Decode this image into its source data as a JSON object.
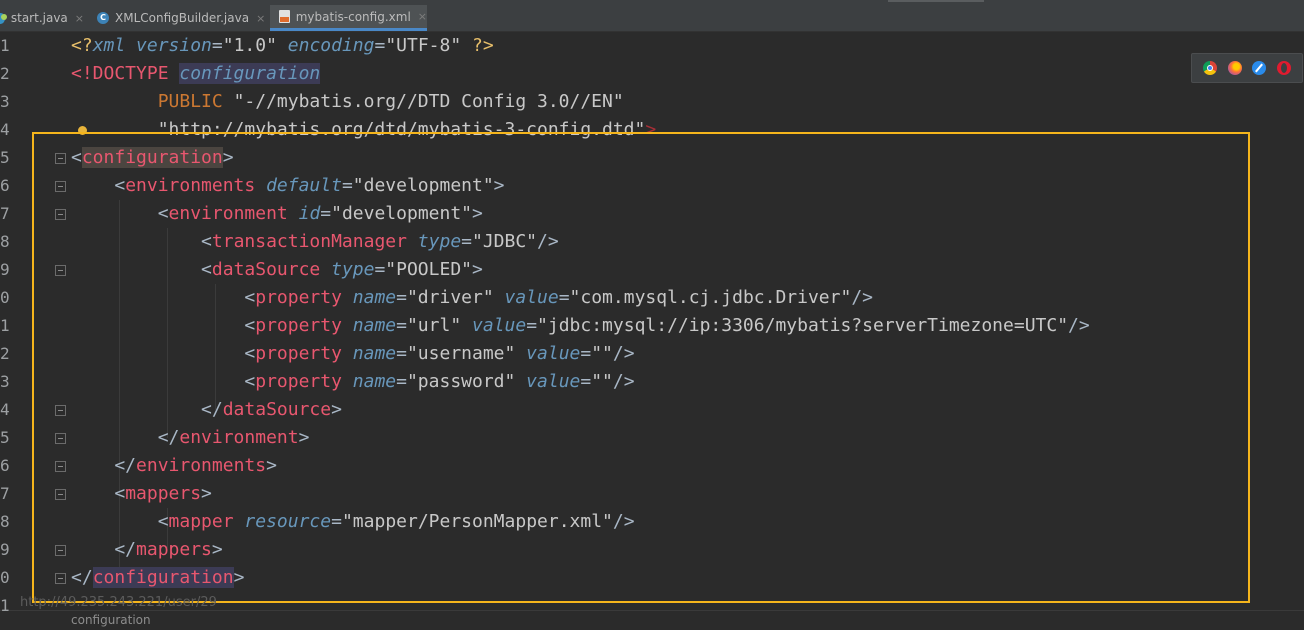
{
  "tabs": [
    {
      "label": "start.java",
      "icon": "java-file-icon",
      "active": false
    },
    {
      "label": "XMLConfigBuilder.java",
      "icon": "class-icon",
      "active": false
    },
    {
      "label": "mybatis-config.xml",
      "icon": "xml-file-icon",
      "active": true
    }
  ],
  "tab_close_glyph": "×",
  "browser_icons": [
    "chrome-icon",
    "firefox-icon",
    "safari-icon",
    "opera-icon"
  ],
  "line_numbers": [
    "1",
    "2",
    "3",
    "4",
    "5",
    "6",
    "7",
    "8",
    "9",
    "0",
    "1",
    "2",
    "3",
    "4",
    "5",
    "6",
    "7",
    "8",
    "9",
    "0",
    "1"
  ],
  "code": {
    "l1": {
      "a": "<?",
      "b": "xml",
      "c": " version",
      "d": "=",
      "e": "\"1.0\"",
      "f": " encoding",
      "g": "=",
      "h": "\"UTF-8\"",
      "i": " ?>"
    },
    "l2": {
      "a": "<!DOCTYPE ",
      "b": "configuration"
    },
    "l3": {
      "a": "        PUBLIC ",
      "b": "\"-//mybatis.org//DTD Config 3.0//EN\""
    },
    "l4": {
      "a": "        \"http://mybatis.org/dtd/mybatis-3-config.dtd\"",
      "b": ">"
    },
    "l5": {
      "a": "<",
      "b": "configuration",
      "c": ">"
    },
    "l6": {
      "a": "    <",
      "b": "environments",
      "c": " default",
      "d": "=",
      "e": "\"development\"",
      "f": ">"
    },
    "l7": {
      "a": "        <",
      "b": "environment",
      "c": " id",
      "d": "=",
      "e": "\"development\"",
      "f": ">"
    },
    "l8": {
      "a": "            <",
      "b": "transactionManager",
      "c": " type",
      "d": "=",
      "e": "\"JDBC\"",
      "f": "/>"
    },
    "l9": {
      "a": "            <",
      "b": "dataSource",
      "c": " type",
      "d": "=",
      "e": "\"POOLED\"",
      "f": ">"
    },
    "l10": {
      "a": "                <",
      "b": "property",
      "c": " name",
      "d": "=",
      "e": "\"driver\"",
      "f": " value",
      "g": "=",
      "h": "\"com.mysql.cj.jdbc.Driver\"",
      "i": "/>"
    },
    "l11": {
      "a": "                <",
      "b": "property",
      "c": " name",
      "d": "=",
      "e": "\"url\"",
      "f": " value",
      "g": "=",
      "h": "\"jdbc:mysql://ip:3306/mybatis?serverTimezone=UTC\"",
      "i": "/>"
    },
    "l12": {
      "a": "                <",
      "b": "property",
      "c": " name",
      "d": "=",
      "e": "\"username\"",
      "f": " value",
      "g": "=",
      "h": "\"\"",
      "i": "/>"
    },
    "l13": {
      "a": "                <",
      "b": "property",
      "c": " name",
      "d": "=",
      "e": "\"password\"",
      "f": " value",
      "g": "=",
      "h": "\"\"",
      "i": "/>"
    },
    "l14": {
      "a": "            </",
      "b": "dataSource",
      "c": ">"
    },
    "l15": {
      "a": "        </",
      "b": "environment",
      "c": ">"
    },
    "l16": {
      "a": "    </",
      "b": "environments",
      "c": ">"
    },
    "l17": {
      "a": "    <",
      "b": "mappers",
      "c": ">"
    },
    "l18": {
      "a": "        <",
      "b": "mapper",
      "c": " resource",
      "d": "=",
      "e": "\"mapper/PersonMapper.xml\"",
      "f": "/>"
    },
    "l19": {
      "a": "    </",
      "b": "mappers",
      "c": ">"
    },
    "l20": {
      "a": "</",
      "b": "configuration",
      "c": ">"
    }
  },
  "watermark": "http://49.235.243.221/user/29",
  "breadcrumb": "configuration",
  "colors": {
    "highlight_box": "#f5b51c",
    "tag": "#e8576f",
    "attribute": "#6897bb",
    "string": "#a5c25c",
    "background": "#2b2b2b"
  }
}
